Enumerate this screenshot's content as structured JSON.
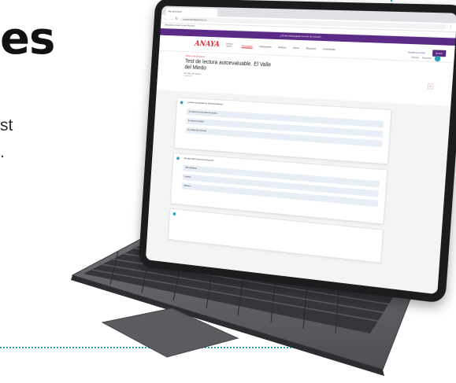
{
  "hero": {
    "heading": "es",
    "line1": "st",
    "line2": "."
  },
  "colors": {
    "accent_teal": "#27a3b4",
    "brand_purple": "#5b2a86",
    "brand_red": "#d7262f"
  },
  "browser": {
    "tab_title": "Test de lectura",
    "url": "anayainfantilyjuvenil.com",
    "bookmarks": "Marcadores     Anaya     Lectura     Recursos"
  },
  "site": {
    "promo_text": "¿Ya has descargado tus test de lectura?",
    "logo": "ANAYA",
    "logo_sub": "Infantil y Juvenil",
    "nav_links": [
      "Novedades",
      "Colecciones",
      "Autores",
      "Libros",
      "Recursos",
      "Coordinador"
    ],
    "nav_button": "Entrar",
    "nav_right": "Accede a tu zona",
    "breadcrumb": "Volver a test de lectura",
    "title": "Test de lectura autoevaluable. El Valle del Miedo",
    "subtitle": "El Valle del Miedo",
    "meta": "Lectura 8",
    "actions": [
      "Anterior",
      "Siguiente"
    ]
  },
  "questions": [
    {
      "prompt": "¿Cuál es la profesión de Sherlock Holmes?",
      "options": [
        "Es inspector de la policía de Londres.",
        "Es detective privado.",
        "Es médico de la Armada."
      ]
    },
    {
      "prompt": "¿En qué lugar transcurre la historia?",
      "options": [
        "Valle del Miedo.",
        "Londres.",
        "Birlstone."
      ]
    }
  ]
}
